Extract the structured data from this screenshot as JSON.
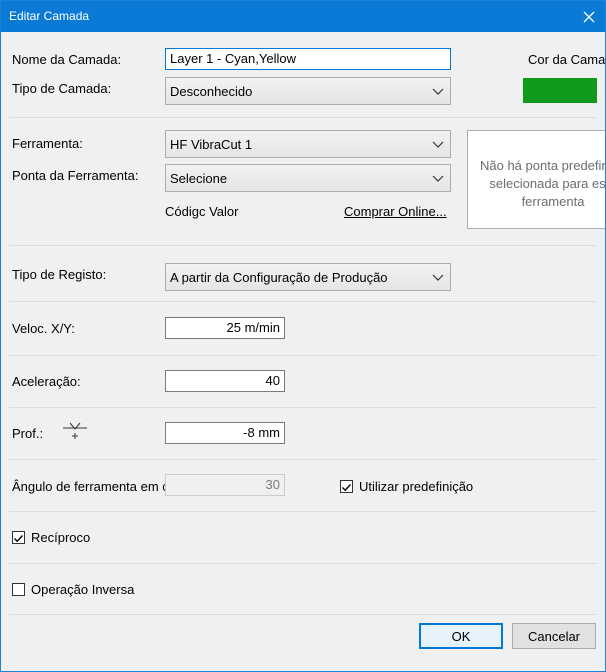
{
  "window": {
    "title": "Editar Camada"
  },
  "layer": {
    "name_label": "Nome da Camada:",
    "name_value": "Layer 1 - Cyan,Yellow",
    "type_label": "Tipo de Camada:",
    "type_value": "Desconhecido",
    "color_label": "Cor da Camada",
    "color": "#109a1c"
  },
  "tool": {
    "tool_label": "Ferramenta:",
    "tool_value": "HF VibraCut 1",
    "tip_label": "Ponta da Ferramenta:",
    "tip_value": "Selecione",
    "code_value_label": "Códigc Valor",
    "buy_online_link": "Comprar Online...",
    "no_tip_message": "Não há ponta predefinida selecionada para esta ferramenta"
  },
  "registration": {
    "label": "Tipo de Registo:",
    "value": "A partir da Configuração de Produção"
  },
  "speed": {
    "label": "Veloc. X/Y:",
    "value": "25 m/min"
  },
  "acceleration": {
    "label": "Aceleração:",
    "value": "40"
  },
  "depth": {
    "label": "Prof.:",
    "value": "-8 mm"
  },
  "tool_angle": {
    "label": "Ângulo de ferramenta em c",
    "value": "30",
    "use_default_label": "Utilizar predefinição",
    "use_default_checked": true
  },
  "reciprocal": {
    "label": "Recíproco",
    "checked": true
  },
  "inverse_operation": {
    "label": "Operação Inversa",
    "checked": false
  },
  "buttons": {
    "ok": "OK",
    "cancel": "Cancelar"
  }
}
